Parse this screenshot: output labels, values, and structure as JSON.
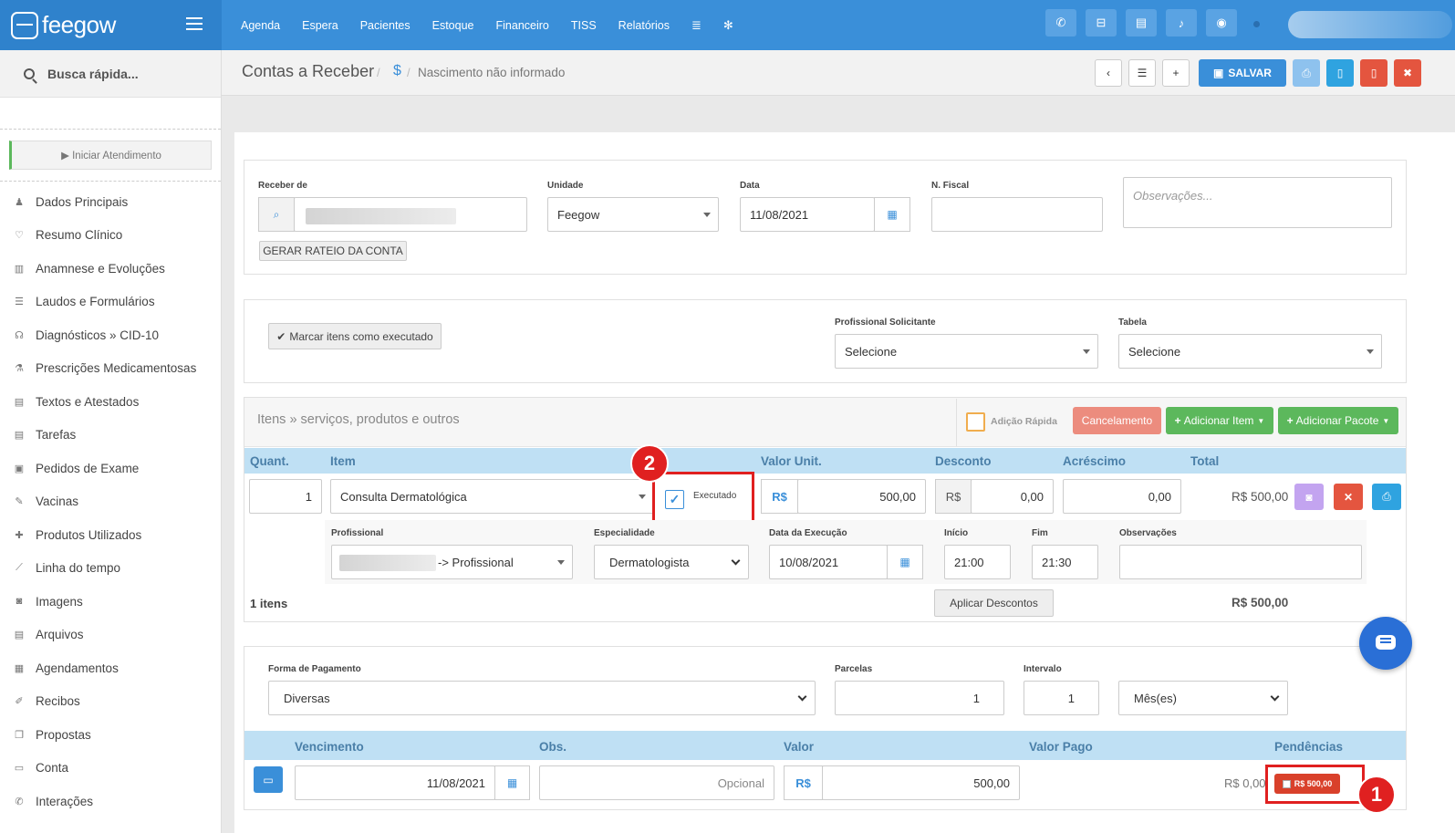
{
  "brand": {
    "name": "feegow"
  },
  "nav": {
    "items": [
      "Agenda",
      "Espera",
      "Pacientes",
      "Estoque",
      "Financeiro",
      "TISS",
      "Relatórios"
    ]
  },
  "sidebar": {
    "search_label": "Busca rápida...",
    "start_label": "▶ Iniciar Atendimento",
    "items": [
      {
        "icon": "user-icon",
        "label": "Dados Principais"
      },
      {
        "icon": "heart-icon",
        "label": "Resumo Clínico"
      },
      {
        "icon": "bar-chart-icon",
        "label": "Anamnese e Evoluções"
      },
      {
        "icon": "list-icon",
        "label": "Laudos e Formulários"
      },
      {
        "icon": "stethoscope-icon",
        "label": "Diagnósticos » CID-10"
      },
      {
        "icon": "flask-icon",
        "label": "Prescrições Medicamentosas"
      },
      {
        "icon": "file-icon",
        "label": "Textos e Atestados"
      },
      {
        "icon": "file-icon",
        "label": "Tarefas"
      },
      {
        "icon": "hospital-icon",
        "label": "Pedidos de Exame"
      },
      {
        "icon": "syringe-icon",
        "label": "Vacinas"
      },
      {
        "icon": "medkit-icon",
        "label": "Produtos Utilizados"
      },
      {
        "icon": "line-chart-icon",
        "label": "Linha do tempo"
      },
      {
        "icon": "camera-icon",
        "label": "Imagens"
      },
      {
        "icon": "file-icon",
        "label": "Arquivos"
      },
      {
        "icon": "calendar-icon",
        "label": "Agendamentos"
      },
      {
        "icon": "edit-icon",
        "label": "Recibos"
      },
      {
        "icon": "copy-icon",
        "label": "Propostas"
      },
      {
        "icon": "money-icon",
        "label": "Conta"
      },
      {
        "icon": "phone-icon",
        "label": "Interações"
      }
    ]
  },
  "header": {
    "title": "Contas a Receber",
    "breadcrumb_icon": "$",
    "breadcrumb_sub": "Nascimento não informado",
    "save_label": "SALVAR"
  },
  "form": {
    "receber_de_label": "Receber de",
    "gerar_rateio_label": "GERAR RATEIO DA CONTA",
    "unidade_label": "Unidade",
    "unidade_value": "Feegow",
    "data_label": "Data",
    "data_value": "11/08/2021",
    "nfiscal_label": "N. Fiscal",
    "obs_placeholder": "Observações...",
    "marcar_label": "Marcar itens como executado",
    "prof_solicitante_label": "Profissional Solicitante",
    "prof_solicitante_value": "Selecione",
    "tabela_label": "Tabela",
    "tabela_value": "Selecione"
  },
  "items": {
    "title": "Itens » serviços, produtos e outros",
    "adicao_rapida": "Adição Rápida",
    "cancelamento": "Cancelamento",
    "adicionar_item": "Adicionar Item",
    "adicionar_pacote": "Adicionar Pacote",
    "columns": [
      "Quant.",
      "Item",
      "Valor Unit.",
      "Desconto",
      "Acréscimo",
      "Total"
    ],
    "row": {
      "quant": "1",
      "item": "Consulta Dermatológica",
      "executado": "Executado",
      "currency": "R$",
      "valor_unit": "500,00",
      "desconto": "0,00",
      "acrescimo": "0,00",
      "total": "R$ 500,00"
    },
    "detail": {
      "profissional_label": "Profissional",
      "profissional_value": "-> Profissional",
      "especialidade_label": "Especialidade",
      "especialidade_value": "Dermatologista",
      "data_exec_label": "Data da Execução",
      "data_exec_value": "10/08/2021",
      "inicio_label": "Início",
      "inicio_value": "21:00",
      "fim_label": "Fim",
      "fim_value": "21:30",
      "obs_label": "Observações"
    },
    "count": "1 itens",
    "aplicar_descontos": "Aplicar Descontos",
    "footer_total": "R$ 500,00"
  },
  "payment": {
    "forma_label": "Forma de Pagamento",
    "forma_value": "Diversas",
    "parcelas_label": "Parcelas",
    "parcelas_value": "1",
    "intervalo_label": "Intervalo",
    "intervalo_value": "1",
    "periodo_value": "Mês(es)",
    "columns": [
      "Vencimento",
      "Obs.",
      "Valor",
      "Valor Pago",
      "Pendências"
    ],
    "row": {
      "vencimento": "11/08/2021",
      "obs_placeholder": "Opcional",
      "currency": "R$",
      "valor": "500,00",
      "valor_pago": "R$ 0,00",
      "pendencia": "R$ 500,00"
    }
  },
  "annotations": {
    "badge1": "1",
    "badge2": "2"
  },
  "colors": {
    "primary": "#3a8fd9",
    "success": "#5cb85c",
    "danger": "#e4553f",
    "highlight": "#e02020"
  }
}
